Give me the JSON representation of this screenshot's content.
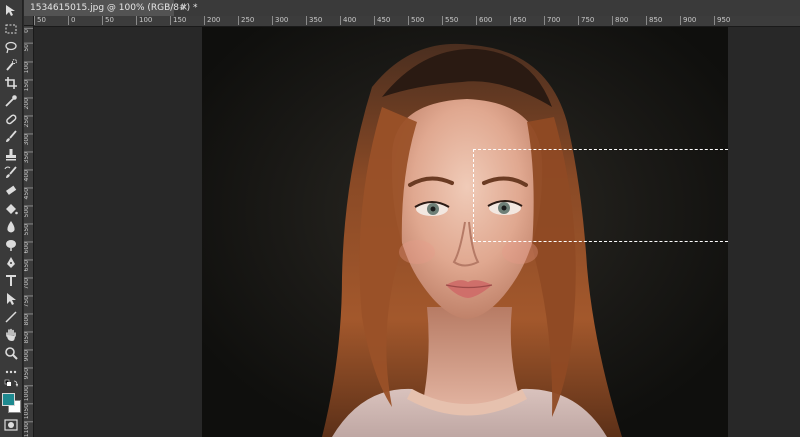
{
  "document": {
    "tab_title": "1534615015.jpg @ 100% (RGB/8#) *",
    "close_glyph": "×"
  },
  "rulers": {
    "top_labels": [
      "50",
      "0",
      "50",
      "100",
      "150",
      "200",
      "250",
      "300",
      "350",
      "400",
      "450",
      "500",
      "550",
      "600",
      "650",
      "700",
      "750",
      "800",
      "850",
      "900",
      "950"
    ],
    "left_labels": [
      "0",
      "50",
      "100",
      "150",
      "200",
      "250",
      "300",
      "350",
      "400",
      "450",
      "500",
      "550",
      "600",
      "650",
      "700",
      "750",
      "800",
      "850",
      "900",
      "950",
      "1000",
      "1050",
      "1100"
    ]
  },
  "toolbar": {
    "tools": [
      "move-tool-icon",
      "rectangular-marquee-icon",
      "lasso-icon",
      "quick-selection-icon",
      "crop-icon",
      "eyedropper-icon",
      "spot-healing-icon",
      "brush-icon",
      "clone-stamp-icon",
      "history-brush-icon",
      "eraser-icon",
      "paint-bucket-icon",
      "blur-icon",
      "dodge-icon",
      "pen-icon",
      "type-icon",
      "path-selection-icon",
      "line-tool-icon",
      "hand-icon",
      "zoom-icon"
    ],
    "foreground_color": "#1e8a90",
    "background_color": "#ffffff"
  },
  "colors": {
    "panel": "#3a3a3a",
    "workspace": "#282828",
    "selection": "#ffffff"
  }
}
